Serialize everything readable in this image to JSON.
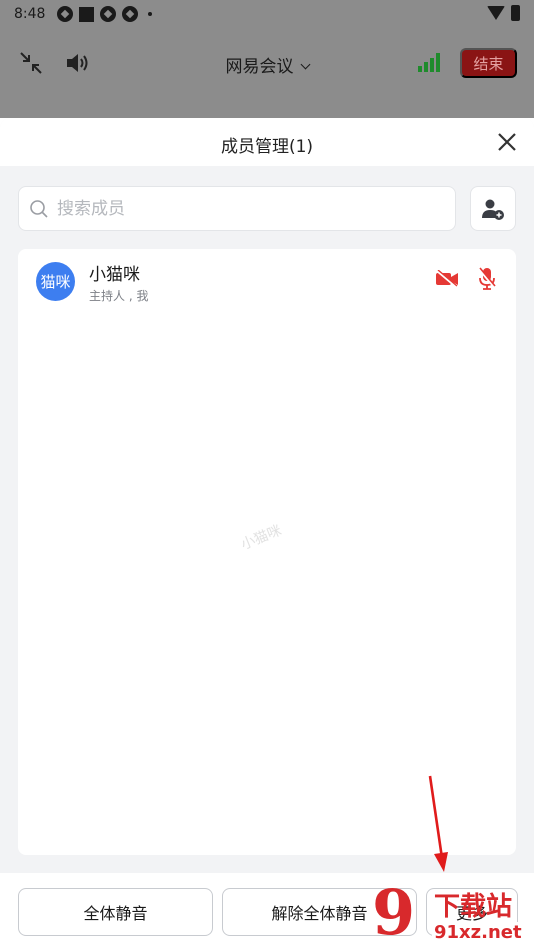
{
  "status_bar": {
    "time": "8:48"
  },
  "meeting_bar": {
    "title": "网易会议",
    "end_label": "结束"
  },
  "sheet": {
    "title": "成员管理(1)",
    "search": {
      "placeholder": "搜索成员",
      "value": ""
    },
    "members": [
      {
        "avatar_text": "猫咪",
        "name": "小猫咪",
        "role": "主持人 , 我",
        "camera": "off",
        "mic": "off"
      }
    ],
    "watermark": "小猫咪",
    "footer": {
      "mute_all": "全体静音",
      "unmute_all": "解除全体静音",
      "more": "更多"
    }
  },
  "overlay": {
    "site_mark_name": "下载站",
    "site_mark_url": "91xz.net"
  },
  "colors": {
    "accent_blue": "#3d7ef0",
    "danger_red": "#e53935",
    "signal_green": "#1f8b2c",
    "end_button": "#8a1414"
  },
  "icons": [
    "shrink-icon",
    "speaker-icon",
    "chevron-down-icon",
    "signal-icon",
    "close-icon",
    "search-icon",
    "add-member-icon",
    "camera-off-icon",
    "mic-off-icon",
    "wifi-icon",
    "battery-icon"
  ]
}
